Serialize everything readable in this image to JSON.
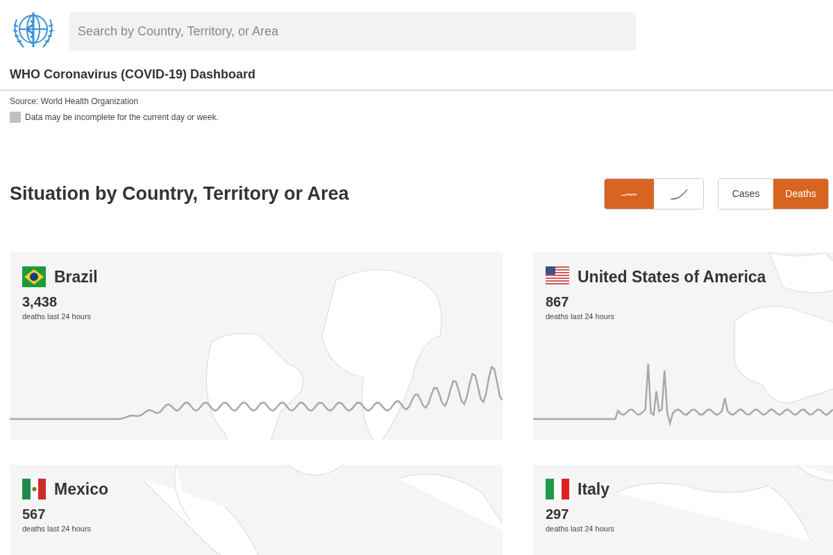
{
  "header": {
    "search": {
      "placeholder": "Search by Country, Territory, or Area"
    },
    "title": "WHO Coronavirus (COVID-19) Dashboard"
  },
  "source": "Source: World Health Organization",
  "note": "Data may be incomplete for the current day or week.",
  "section": {
    "title": "Situation by Country, Territory or Area",
    "chart_toggle": [
      {
        "kind": "daily",
        "selected": true
      },
      {
        "kind": "cumulative",
        "selected": false
      }
    ],
    "metric_toggle": [
      {
        "label": "Cases",
        "selected": false
      },
      {
        "label": "Deaths",
        "selected": true
      }
    ]
  },
  "cards": [
    {
      "kind": "brazil",
      "name": "Brazil",
      "value": "3,438",
      "caption": "deaths last 24 hours",
      "sparkline": {
        "kind": "waves"
      }
    },
    {
      "kind": "usa",
      "name": "United States of America",
      "value": "867",
      "caption": "deaths last 24 hours",
      "sparkline": {
        "kind": "spikes"
      }
    },
    {
      "kind": "mexico",
      "name": "Mexico",
      "value": "567",
      "caption": "deaths last 24 hours"
    },
    {
      "kind": "italy",
      "name": "Italy",
      "value": "297",
      "caption": "deaths last 24 hours"
    }
  ]
}
